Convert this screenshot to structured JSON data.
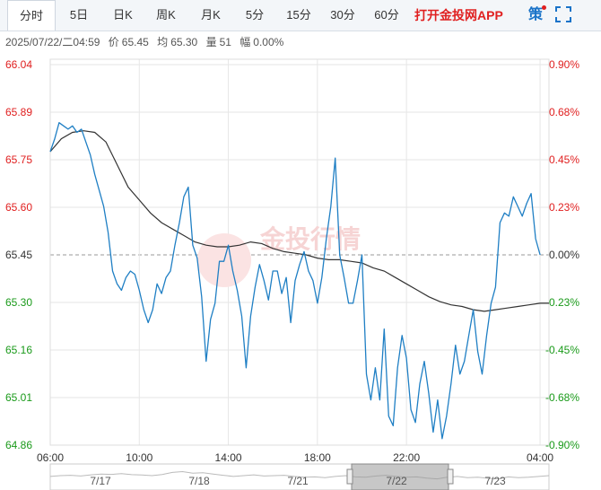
{
  "tabs": [
    {
      "label": "分时",
      "active": true
    },
    {
      "label": "5日"
    },
    {
      "label": "日K"
    },
    {
      "label": "周K"
    },
    {
      "label": "月K"
    },
    {
      "label": "5分"
    },
    {
      "label": "15分"
    },
    {
      "label": "30分"
    },
    {
      "label": "60分"
    }
  ],
  "promo_label": "打开金投网APP",
  "strategy_label": "策",
  "info": {
    "datetime": "2025/07/22/二04:59",
    "price_label": "价",
    "price": "65.45",
    "avg_label": "均",
    "avg": "65.30",
    "volume_label": "量",
    "volume": "51",
    "change_label": "幅",
    "change": "0.00%"
  },
  "watermark": "金投行情",
  "colors": {
    "price_line": "#1f7fc4",
    "avg_line": "#333333",
    "up": "#e02020",
    "down": "#1a9a1a",
    "neutral": "#333333",
    "grid": "#e6e6e6"
  },
  "chart_data": {
    "type": "line",
    "reference_price": 65.45,
    "ylim": [
      64.86,
      66.04
    ],
    "y_ticks_left": [
      "66.04",
      "65.89",
      "65.75",
      "65.60",
      "65.45",
      "65.30",
      "65.16",
      "65.01",
      "64.86"
    ],
    "y_ticks_right": [
      "0.90%",
      "0.68%",
      "0.45%",
      "0.23%",
      "0.00%",
      "-0.23%",
      "-0.45%",
      "-0.68%",
      "-0.90%"
    ],
    "x_ticks": [
      "06:00",
      "10:00",
      "14:00",
      "18:00",
      "22:00",
      "04:00"
    ],
    "x_hours": [
      0,
      4,
      8,
      12,
      16,
      22
    ],
    "x_range_hours": [
      0,
      22.4
    ],
    "series": [
      {
        "x": [
          0,
          0.2,
          0.4,
          0.6,
          0.8,
          1.0,
          1.2,
          1.4,
          1.6,
          1.8,
          2.0,
          2.2,
          2.4,
          2.6,
          2.8,
          3.0,
          3.2,
          3.4,
          3.6,
          3.8,
          4.0,
          4.2,
          4.4,
          4.6,
          4.8,
          5.0,
          5.2,
          5.4,
          5.6,
          5.8,
          6.0,
          6.2,
          6.4,
          6.6,
          6.8,
          7.0,
          7.2,
          7.4,
          7.6,
          7.8,
          8.0,
          8.2,
          8.4,
          8.6,
          8.8,
          9.0,
          9.2,
          9.4,
          9.6,
          9.8,
          10.0,
          10.2,
          10.4,
          10.6,
          10.8,
          11.0,
          11.2,
          11.4,
          11.6,
          11.8,
          12.0,
          12.2,
          12.4,
          12.6,
          12.8,
          13.0,
          13.2,
          13.4,
          13.6,
          13.8,
          14.0,
          14.2,
          14.4,
          14.6,
          14.8,
          15.0,
          15.2,
          15.4,
          15.6,
          15.8,
          16.0,
          16.2,
          16.4,
          16.6,
          16.8,
          17.0,
          17.2,
          17.4,
          17.6,
          17.8,
          18.0,
          18.2,
          18.4,
          18.6,
          18.8,
          19.0,
          19.2,
          19.4,
          19.6,
          19.8,
          20.0,
          20.2,
          20.4,
          20.6,
          20.8,
          21.0,
          21.2,
          21.4,
          21.6,
          21.8,
          22.0
        ],
        "values": [
          65.77,
          65.81,
          65.86,
          65.85,
          65.84,
          65.85,
          65.83,
          65.84,
          65.8,
          65.76,
          65.7,
          65.65,
          65.6,
          65.52,
          65.4,
          65.36,
          65.34,
          65.38,
          65.4,
          65.39,
          65.34,
          65.28,
          65.24,
          65.28,
          65.36,
          65.33,
          65.38,
          65.4,
          65.48,
          65.55,
          65.63,
          65.66,
          65.48,
          65.44,
          65.32,
          65.12,
          65.25,
          65.3,
          65.43,
          65.43,
          65.48,
          65.4,
          65.34,
          65.26,
          65.1,
          65.26,
          65.35,
          65.42,
          65.37,
          65.31,
          65.4,
          65.4,
          65.33,
          65.38,
          65.24,
          65.37,
          65.42,
          65.46,
          65.4,
          65.37,
          65.3,
          65.38,
          65.5,
          65.6,
          65.75,
          65.45,
          65.38,
          65.3,
          65.3,
          65.37,
          65.45,
          65.08,
          65.0,
          65.1,
          65.0,
          65.22,
          64.95,
          64.92,
          65.1,
          65.2,
          65.13,
          64.97,
          64.93,
          65.05,
          65.12,
          65.02,
          64.9,
          65.0,
          64.88,
          64.95,
          65.05,
          65.17,
          65.08,
          65.12,
          65.2,
          65.28,
          65.15,
          65.08,
          65.2,
          65.3,
          65.35,
          65.55,
          65.58,
          65.57,
          65.63,
          65.6,
          65.57,
          65.61,
          65.64,
          65.5,
          65.45
        ]
      },
      {
        "x": [
          0,
          0.5,
          1.0,
          1.5,
          2.0,
          2.5,
          3.0,
          3.5,
          4.0,
          4.5,
          5.0,
          5.5,
          6.0,
          6.5,
          7.0,
          7.5,
          8.0,
          8.5,
          9.0,
          9.5,
          10.0,
          10.5,
          11.0,
          11.5,
          12.0,
          12.5,
          13.0,
          13.5,
          14.0,
          14.5,
          15.0,
          15.5,
          16.0,
          16.5,
          17.0,
          17.5,
          18.0,
          18.5,
          19.0,
          19.5,
          20.0,
          20.5,
          21.0,
          21.5,
          22.0,
          22.4
        ],
        "values": [
          65.77,
          65.81,
          65.83,
          65.835,
          65.83,
          65.8,
          65.73,
          65.66,
          65.62,
          65.58,
          65.55,
          65.53,
          65.51,
          65.49,
          65.48,
          65.475,
          65.475,
          65.48,
          65.49,
          65.485,
          65.47,
          65.46,
          65.455,
          65.45,
          65.44,
          65.435,
          65.435,
          65.43,
          65.425,
          65.41,
          65.4,
          65.38,
          65.36,
          65.34,
          65.32,
          65.305,
          65.295,
          65.29,
          65.28,
          65.275,
          65.28,
          65.285,
          65.29,
          65.295,
          65.3,
          65.3
        ]
      }
    ]
  },
  "navigator": {
    "dates": [
      "7/17",
      "7/18",
      "7/21",
      "7/22",
      "7/23"
    ],
    "spark": [
      0.55,
      0.5,
      0.48,
      0.52,
      0.45,
      0.4,
      0.42,
      0.38,
      0.44,
      0.46,
      0.5,
      0.43,
      0.3,
      0.25,
      0.35,
      0.32,
      0.4,
      0.48,
      0.55,
      0.5,
      0.45,
      0.52,
      0.5,
      0.48,
      0.55,
      0.6,
      0.58,
      0.62,
      0.55,
      0.5,
      0.58,
      0.6,
      0.52,
      0.48,
      0.55,
      0.6,
      0.58,
      0.65,
      0.7,
      0.6,
      0.55,
      0.62,
      0.6,
      0.66,
      0.7,
      0.58,
      0.62,
      0.6,
      0.55,
      0.5
    ]
  }
}
